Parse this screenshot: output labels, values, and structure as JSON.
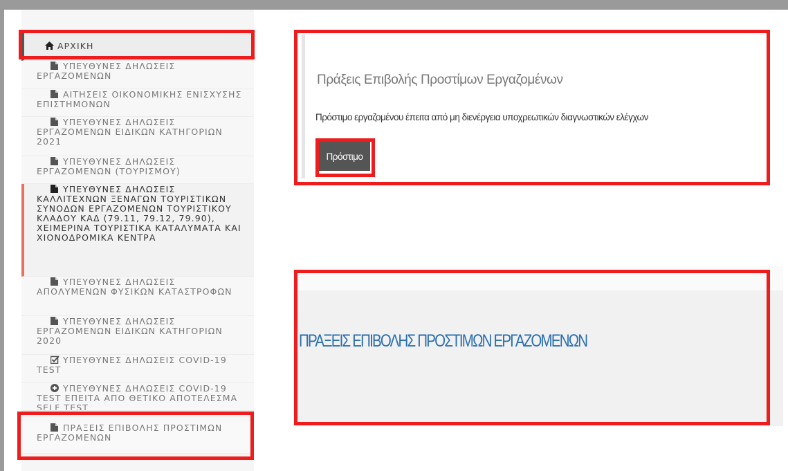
{
  "sidebar": {
    "items": [
      {
        "label": "ΑΡΧΙΚΗ",
        "icon": "home-icon"
      },
      {
        "label": "ΥΠΕΥΘΥΝΕΣ ΔΗΛΩΣΕΙΣ ΕΡΓΑΖΟΜΕΝΩΝ",
        "icon": "file-icon"
      },
      {
        "label": "ΑΙΤΗΣΕΙΣ ΟΙΚΟΝΟΜΙΚΗΣ ΕΝΙΣΧΥΣΗΣ ΕΠΙΣΤΗΜΟΝΩΝ",
        "icon": "file-icon"
      },
      {
        "label": "ΥΠΕΥΘΥΝΕΣ ΔΗΛΩΣΕΙΣ ΕΡΓΑΖΟΜΕΝΩΝ ΕΙΔΙΚΩΝ ΚΑΤΗΓΟΡΙΩΝ 2021",
        "icon": "file-icon"
      },
      {
        "label": "ΥΠΕΥΘΥΝΕΣ ΔΗΛΩΣΕΙΣ ΕΡΓΑΖΟΜΕΝΩΝ (ΤΟΥΡΙΣΜΟΥ)",
        "icon": "file-icon"
      },
      {
        "label": "ΥΠΕΥΘΥΝΕΣ ΔΗΛΩΣΕΙΣ ΚΑΛΛΙΤΕΧΝΩΝ ΞΕΝΑΓΩΝ ΤΟΥΡΙΣΤΙΚΩΝ ΣΥΝΟΔΩΝ ΕΡΓΑΖΟΜΕΝΩΝ ΤΟΥΡΙΣΤΙΚΟΥ ΚΛΑΔΟΥ ΚΑΔ (79.11, 79.12, 79.90), ΧΕΙΜΕΡΙΝΑ ΤΟΥΡΙΣΤΙΚΑ ΚΑΤΑΛΥΜΑΤΑ ΚΑΙ ΧΙΟΝΟΔΡΟΜΙΚΑ ΚΕΝΤΡΑ",
        "icon": "file-icon"
      },
      {
        "label": "ΥΠΕΥΘΥΝΕΣ ΔΗΛΩΣΕΙΣ ΑΠΟΛΥΜΕΝΩΝ ΦΥΣΙΚΩΝ ΚΑΤΑΣΤΡΟΦΩΝ",
        "icon": "file-icon"
      },
      {
        "label": "ΥΠΕΥΘΥΝΕΣ ΔΗΛΩΣΕΙΣ ΕΡΓΑΖΟΜΕΝΩΝ ΕΙΔΙΚΩΝ ΚΑΤΗΓΟΡΙΩΝ 2020",
        "icon": "file-icon"
      },
      {
        "label": "ΥΠΕΥΘΥΝΕΣ ΔΗΛΩΣΕΙΣ COVID-19 TEST",
        "icon": "checkbox-icon"
      },
      {
        "label": "ΥΠΕΥΘΥΝΕΣ ΔΗΛΩΣΕΙΣ COVID-19 TEST ΕΠΕΙΤΑ ΑΠΟ ΘΕΤΙΚΟ ΑΠΟΤΕΛΕΣΜΑ SELF TEST",
        "icon": "plus-circle-icon"
      },
      {
        "label": "ΠΡΑΞΕΙΣ ΕΠΙΒΟΛΗΣ ΠΡΟΣΤΙΜΩΝ ΕΡΓΑΖΟΜΕΝΩΝ",
        "icon": "file-icon"
      }
    ]
  },
  "fines_panel": {
    "title": "Πράξεις Επιβολής Προστίμων Εργαζομένων",
    "description": "Πρόστιμο εργαζομένου έπειτα από μη διενέργεια υποχρεωτικών διαγνωστικών ελέγχων",
    "button_label": "Πρόστιμο"
  },
  "page_header": {
    "title": "ΠΡΑΞΕΙΣ ΕΠΙΒΟΛΗΣ ΠΡΟΣΤΙΜΩΝ ΕΡΓΑΖΟΜΕΝΩΝ"
  },
  "colors": {
    "highlight": "#ee1c1c",
    "active_accent": "#e8735d",
    "header_blue": "#2a6fb0",
    "button_bg": "#555555"
  }
}
